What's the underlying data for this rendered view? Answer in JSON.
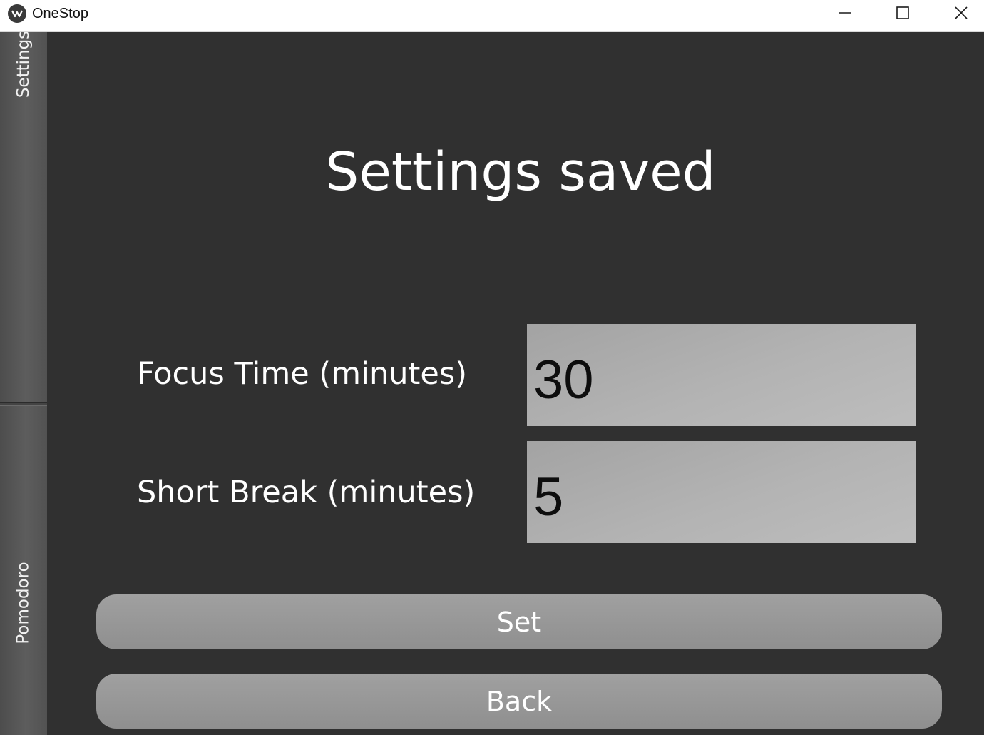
{
  "window": {
    "title": "OneStop",
    "icon": "kivy-logo-icon",
    "controls": [
      "minimize-icon",
      "maximize-icon",
      "close-icon"
    ]
  },
  "tabs": [
    {
      "label": "Settings",
      "selected": true
    },
    {
      "label": "Pomodoro",
      "selected": false
    }
  ],
  "main": {
    "heading": "Settings saved",
    "fields": [
      {
        "label": "Focus Time (minutes)",
        "value": "30"
      },
      {
        "label": "Short Break (minutes)",
        "value": "5"
      }
    ],
    "buttons": {
      "set": "Set",
      "back": "Back"
    }
  },
  "colors": {
    "background": "#303030",
    "tab": "#575757",
    "input": "#b0b0b0",
    "button": "#979797",
    "text": "#ffffff"
  }
}
